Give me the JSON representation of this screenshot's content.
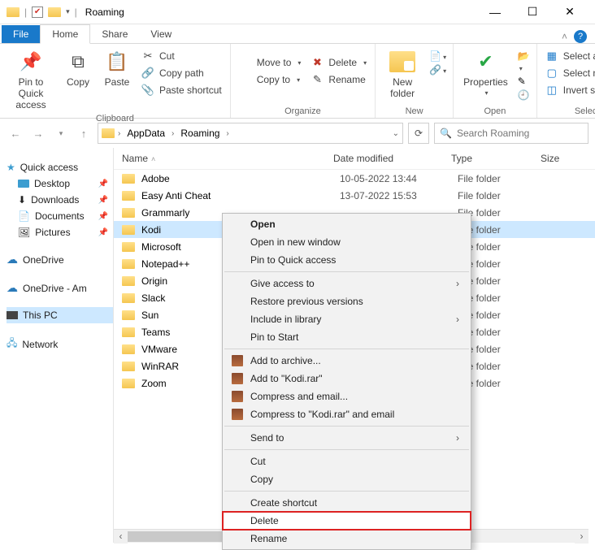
{
  "window": {
    "title": "Roaming"
  },
  "tabs": {
    "file": "File",
    "home": "Home",
    "share": "Share",
    "view": "View"
  },
  "ribbon": {
    "clipboard": {
      "label": "Clipboard",
      "pin": "Pin to Quick access",
      "copy": "Copy",
      "paste": "Paste",
      "cut": "Cut",
      "copy_path": "Copy path",
      "paste_shortcut": "Paste shortcut"
    },
    "organize": {
      "label": "Organize",
      "move_to": "Move to",
      "copy_to": "Copy to",
      "delete": "Delete",
      "rename": "Rename"
    },
    "new": {
      "label": "New",
      "new_folder": "New folder"
    },
    "open": {
      "label": "Open",
      "properties": "Properties"
    },
    "select": {
      "label": "Select",
      "select_all": "Select all",
      "select_none": "Select none",
      "invert": "Invert selection"
    }
  },
  "breadcrumb": {
    "items": [
      "AppData",
      "Roaming"
    ]
  },
  "search": {
    "placeholder": "Search Roaming"
  },
  "sidebar": {
    "quick_access": "Quick access",
    "desktop": "Desktop",
    "downloads": "Downloads",
    "documents": "Documents",
    "pictures": "Pictures",
    "onedrive": "OneDrive",
    "onedrive_am": "OneDrive - Am",
    "this_pc": "This PC",
    "network": "Network"
  },
  "columns": {
    "name": "Name",
    "date": "Date modified",
    "type": "Type",
    "size": "Size"
  },
  "rows": [
    {
      "name": "Adobe",
      "date": "10-05-2022 13:44",
      "type": "File folder"
    },
    {
      "name": "Easy Anti Cheat",
      "date": "13-07-2022 15:53",
      "type": "File folder"
    },
    {
      "name": "Grammarly",
      "date": "",
      "type": "File folder"
    },
    {
      "name": "Kodi",
      "date": "",
      "type": "File folder",
      "selected": true
    },
    {
      "name": "Microsoft",
      "date": "",
      "type": "File folder"
    },
    {
      "name": "Notepad++",
      "date": "",
      "type": "File folder"
    },
    {
      "name": "Origin",
      "date": "",
      "type": "File folder"
    },
    {
      "name": "Slack",
      "date": "",
      "type": "File folder"
    },
    {
      "name": "Sun",
      "date": "",
      "type": "File folder"
    },
    {
      "name": "Teams",
      "date": "",
      "type": "File folder"
    },
    {
      "name": "VMware",
      "date": "",
      "type": "File folder"
    },
    {
      "name": "WinRAR",
      "date": "",
      "type": "File folder"
    },
    {
      "name": "Zoom",
      "date": "",
      "type": "File folder"
    }
  ],
  "context_menu": {
    "open": "Open",
    "open_new": "Open in new window",
    "pin_qa": "Pin to Quick access",
    "give_access": "Give access to",
    "restore": "Restore previous versions",
    "include_lib": "Include in library",
    "pin_start": "Pin to Start",
    "add_archive": "Add to archive...",
    "add_rar": "Add to \"Kodi.rar\"",
    "compress_email": "Compress and email...",
    "compress_rar_email": "Compress to \"Kodi.rar\" and email",
    "send_to": "Send to",
    "cut": "Cut",
    "copy": "Copy",
    "create_shortcut": "Create shortcut",
    "delete": "Delete",
    "rename": "Rename"
  }
}
